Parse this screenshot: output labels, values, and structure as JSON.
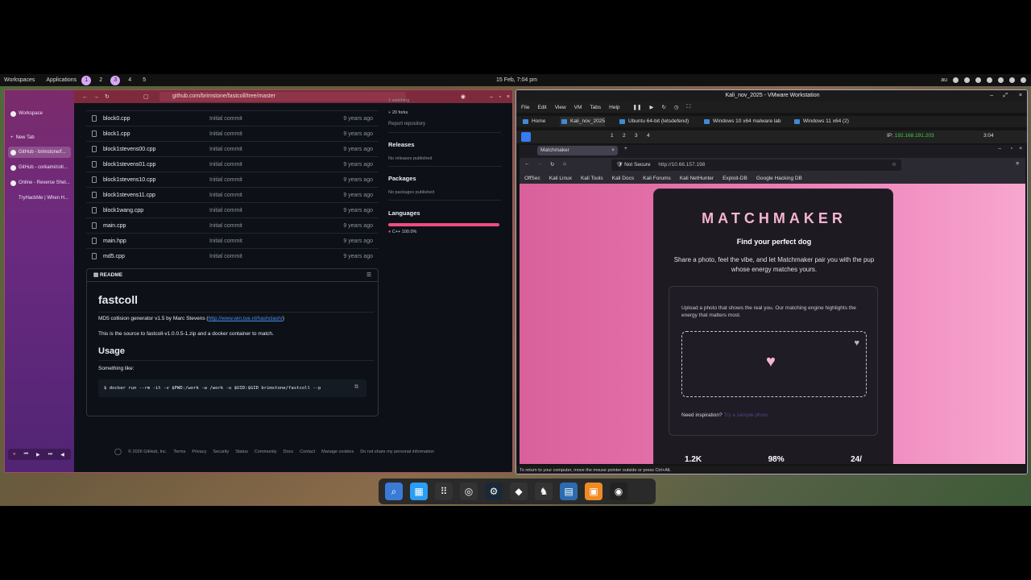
{
  "topbar": {
    "workspaces_label": "Workspaces",
    "applications_label": "Applications",
    "workspace_numbers": [
      "1",
      "2",
      "3",
      "4",
      "5"
    ],
    "clock": "15 Feb, 7:04 pm",
    "lang": "au"
  },
  "browser": {
    "url": "github.com/brimstone/fastcoll/tree/master",
    "sidebar": {
      "workspace": "Workspace",
      "new_tab": "New Tab",
      "tabs": [
        "GitHub - brimstone/f...",
        "GitHub - corkami/coll...",
        "Online - Reverse Shel...",
        "TryHackMe | When H..."
      ]
    },
    "files": [
      {
        "name": "block0.cpp",
        "msg": "Initial commit",
        "time": "9 years ago"
      },
      {
        "name": "block1.cpp",
        "msg": "Initial commit",
        "time": "9 years ago"
      },
      {
        "name": "block1stevens00.cpp",
        "msg": "Initial commit",
        "time": "9 years ago"
      },
      {
        "name": "block1stevens01.cpp",
        "msg": "Initial commit",
        "time": "9 years ago"
      },
      {
        "name": "block1stevens10.cpp",
        "msg": "Initial commit",
        "time": "9 years ago"
      },
      {
        "name": "block1stevens11.cpp",
        "msg": "Initial commit",
        "time": "9 years ago"
      },
      {
        "name": "block1wang.cpp",
        "msg": "Initial commit",
        "time": "9 years ago"
      },
      {
        "name": "main.cpp",
        "msg": "Initial commit",
        "time": "9 years ago"
      },
      {
        "name": "main.hpp",
        "msg": "Initial commit",
        "time": "9 years ago"
      },
      {
        "name": "md5.cpp",
        "msg": "Initial commit",
        "time": "9 years ago"
      }
    ],
    "readme": {
      "tab": "README",
      "title": "fastcoll",
      "line1": "MD5 collision generator v1.5 by Marc Stevens (",
      "link": "http://www.win.tue.nl/hashclash/",
      "line1_end": ")",
      "line2": "This is the source to fastcoll-v1.0.0.5-1.zip and a docker container to match.",
      "usage": "Usage",
      "something": "Something like:",
      "code": "$ docker run --rm -it -v $PWD:/work -w /work -u $UID:$GID brimstone/fastcoll --p"
    },
    "side": {
      "watching": "1 watching",
      "forks": "20 forks",
      "report": "Report repository",
      "releases": "Releases",
      "no_releases": "No releases published",
      "packages": "Packages",
      "no_packages": "No packages published",
      "languages": "Languages",
      "lang": "C++ 100.0%",
      "lang_fraction": 1.0
    },
    "footer": [
      "© 2026 GitHub, Inc.",
      "Terms",
      "Privacy",
      "Security",
      "Status",
      "Community",
      "Docs",
      "Contact",
      "Manage cookies",
      "Do not share my personal information"
    ]
  },
  "vmware": {
    "title": "Kali_nov_2025 - VMware Workstation",
    "menu": [
      "File",
      "Edit",
      "View",
      "VM",
      "Tabs",
      "Help"
    ],
    "tabs": [
      "Home",
      "Kali_nov_2025",
      "Ubuntu 64-bit (letsdefend)",
      "Windows 10 x64 malware lab",
      "Windows 11 x64 (2)"
    ],
    "kali_ws": [
      "1",
      "2",
      "3",
      "4"
    ],
    "ip_label": "IP:",
    "ip": "192.168.191.203",
    "kali_time": "3:04",
    "status": "To return to your computer, move the mouse pointer outside or press Ctrl+Alt."
  },
  "firefox": {
    "tab": "Matchmaker",
    "not_secure": "Not Secure",
    "url": "http://10.66.157.198",
    "bookmarks": [
      "OffSec",
      "Kali Linux",
      "Kali Tools",
      "Kali Docs",
      "Kali Forums",
      "Kali NetHunter",
      "Exploit-DB",
      "Google Hacking DB"
    ]
  },
  "matchmaker": {
    "brand": "MATCHMAKER",
    "subtitle": "Find your perfect dog",
    "description": "Share a photo, feel the vibe, and let Matchmaker pair you with the pup whose energy matches yours.",
    "upload_text": "Upload a photo that shows the real you. Our matching engine highlights the energy that matters most.",
    "inspiration": "Need inspiration?",
    "stats": [
      "1.2K",
      "98%",
      "24/"
    ]
  },
  "colors": {
    "accent_pink": "#f6b4d3",
    "gh_bg": "#0d1117",
    "lang_bar": "#f34b7d"
  }
}
